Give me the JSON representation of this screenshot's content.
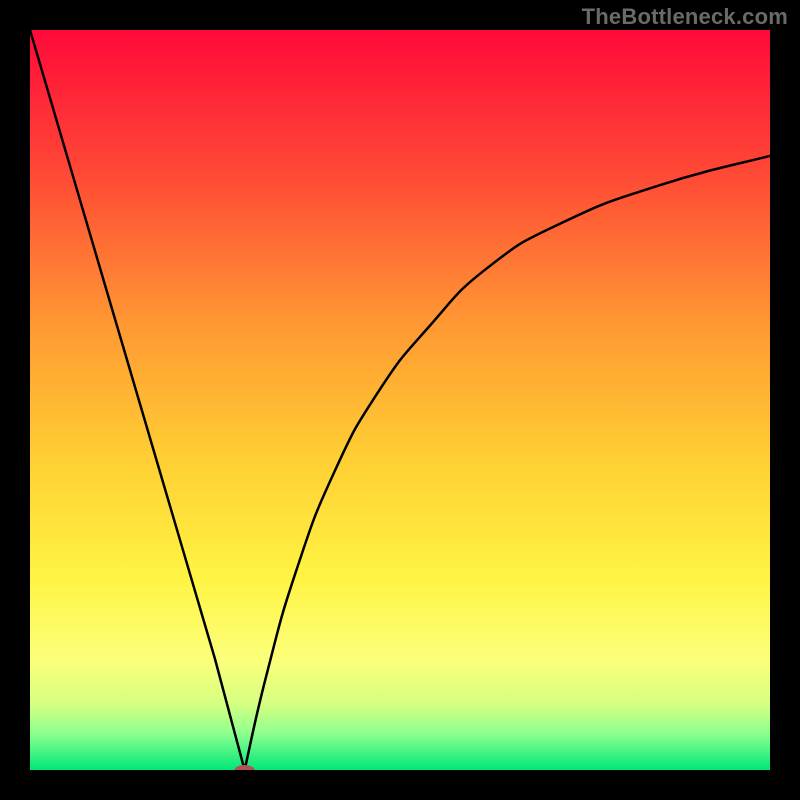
{
  "watermark": "TheBottleneck.com",
  "chart_data": {
    "type": "line",
    "title": "",
    "xlabel": "",
    "ylabel": "",
    "xlim": [
      0,
      100
    ],
    "ylim": [
      0,
      100
    ],
    "grid": false,
    "curve": {
      "minimum_x": 29,
      "series": [
        {
          "name": "left-branch-descending",
          "x": [
            0,
            5,
            10,
            15,
            20,
            25,
            29
          ],
          "y": [
            100,
            83,
            66,
            49,
            32,
            15,
            0
          ]
        },
        {
          "name": "right-branch-ascending",
          "x": [
            29,
            32,
            36,
            41,
            47,
            54,
            62,
            72,
            85,
            100
          ],
          "y": [
            0,
            13,
            27,
            40,
            51,
            60,
            68,
            74,
            79,
            83
          ]
        }
      ]
    },
    "marker": {
      "x": 29,
      "y": 0,
      "color": "#b45058"
    },
    "background_gradient": {
      "type": "vertical",
      "stops": [
        {
          "pos": 0.0,
          "color": "#ff0a3a"
        },
        {
          "pos": 0.18,
          "color": "#ff4435"
        },
        {
          "pos": 0.4,
          "color": "#ff9933"
        },
        {
          "pos": 0.58,
          "color": "#ffcf33"
        },
        {
          "pos": 0.74,
          "color": "#fff443"
        },
        {
          "pos": 0.85,
          "color": "#fcff7a"
        },
        {
          "pos": 0.91,
          "color": "#d6ff80"
        },
        {
          "pos": 0.95,
          "color": "#8fff8f"
        },
        {
          "pos": 1.0,
          "color": "#00e878"
        }
      ]
    }
  }
}
